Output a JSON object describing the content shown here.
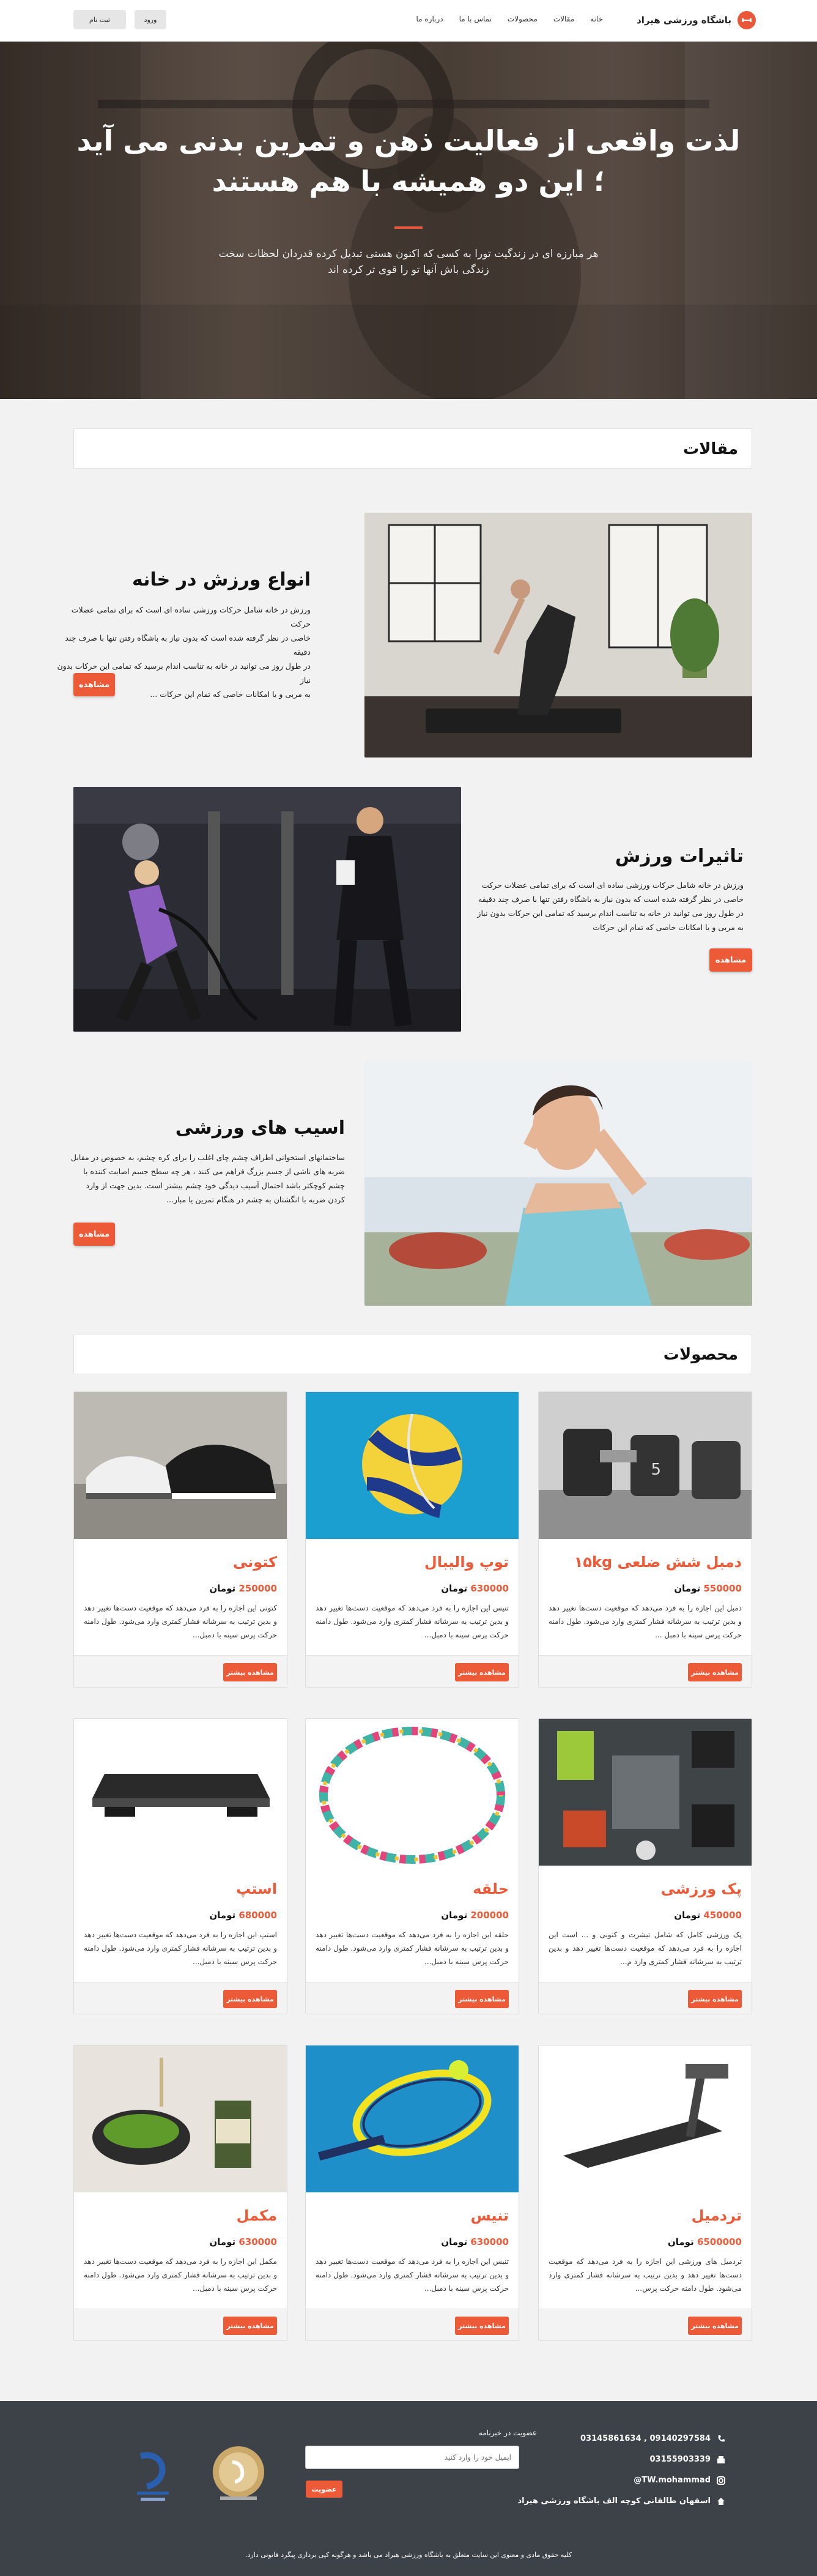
{
  "nav": {
    "brand": "باشگاه ورزشی هیراد",
    "menu": [
      "خانه",
      "مقالات",
      "محصولات",
      "تماس با ما",
      "درباره ما"
    ],
    "login_label": "ورود",
    "signup_label": "ثبت نام"
  },
  "hero": {
    "title_line1": "لذت واقعی از فعالیت ذهن و تمرین بدنی می آید",
    "title_line2": "؛ این دو همیشه با هم هستند",
    "subtitle_line1": "هر مبارزه ای در زندگیت تورا به کسی که اکنون هستی تبدیل کرده قدردان لحظات سخت",
    "subtitle_line2": "زندگی باش آنها تو را قوی تر کرده اند"
  },
  "articles_section": {
    "title": "مقالات",
    "read_more_label": "مشاهده",
    "items": [
      {
        "title": "انواع ورزش در خانه",
        "lines": [
          "ورزش در خانه شامل حرکات ورزشی ساده ای است که برای تمامی عضلات حرکت",
          "خاصی در نظر گرفته شده است که بدون نیاز به باشگاه رفتن تنها با صرف چند دقیقه",
          "در طول روز می توانید در خانه به تناسب اندام برسید که تمامی این حرکات بدون نیاز",
          "به مربی و یا امکانات خاصی که تمام این حرکات ..."
        ]
      },
      {
        "title": "تاثیرات ورزش",
        "lines": [
          "ورزش در خانه شامل حرکات ورزشی ساده ای است که برای تمامی عضلات حرکت",
          "خاصی در نظر گرفته شده است که بدون نیاز به باشگاه رفتن تنها با صرف چند دقیقه",
          "در طول روز می توانید در خانه به تناسب اندام برسید که تمامی این حرکات بدون نیاز",
          "به مربی و یا امکانات خاصی که تمام این حرکات"
        ]
      },
      {
        "title": "اسیب های ورزشی",
        "lines": [
          "ساختمانهای استخوانی اطراف چشم چای اغلب را برای کره چشم، به خصوص در مقابل",
          "ضربه های ناشی از جسم بزرگ فراهم می کنند ، هر چه سطح جسم اصابت کننده با",
          "چشم کوچکتر باشد احتمال آسیب دیدگی خود چشم بیشتر است. بدین جهت از وارد",
          "کردن ضربه با انگشتان به چشم در هنگام تمرین یا مبار..."
        ]
      }
    ]
  },
  "products_section": {
    "title": "محصولات",
    "currency": "تومان",
    "view_label": "مشاهده بیشتر",
    "items": [
      {
        "name": "دمبل شش ضلعی ۱۵kg",
        "price": "550000",
        "desc": "دمبل این اجازه را به فرد می‌دهد که موقعیت دست‌ها تغییر دهد و بدین ترتیب به سرشانه فشار کمتری وارد می‌شود. طول دامنه حرکت پرس سینه با دمبل ..."
      },
      {
        "name": "توپ والیبال",
        "price": "630000",
        "desc": "تنیس این اجازه را به فرد می‌دهد که موقعیت دست‌ها تغییر دهد و بدین ترتیب به سرشانه فشار کمتری وارد می‌شود. طول دامنه حرکت پرس سینه با دمبل..."
      },
      {
        "name": "کتونی",
        "price": "250000",
        "desc": "کتونی این اجازه را به فرد می‌دهد که موقعیت دست‌ها تغییر دهد و بدین ترتیب به سرشانه فشار کمتری وارد می‌شود. طول دامنه حرکت پرس سینه با دمبل..."
      },
      {
        "name": "پک ورزشی",
        "price": "450000",
        "desc": "پک ورزشی کامل که شامل تیشرت و کتونی و ... است این اجازه را به فرد می‌دهد که موقعیت دست‌ها تغییر دهد و بدین ترتیب به سرشانه فشار کمتری وارد م..."
      },
      {
        "name": "حلقه",
        "price": "200000",
        "desc": "حلقه این اجازه را به فرد می‌دهد که موقعیت دست‌ها تغییر دهد و بدین ترتیب به سرشانه فشار کمتری وارد می‌شود. طول دامنه حرکت پرس سینه با دمبل..."
      },
      {
        "name": "استپ",
        "price": "680000",
        "desc": "استپ این اجازه را به فرد می‌دهد که موقعیت دست‌ها تغییر دهد و بدین ترتیب به سرشانه فشار کمتری وارد می‌شود. طول دامنه حرکت پرس سینه با دمبل..."
      },
      {
        "name": "تردمیل",
        "price": "6500000",
        "desc": "تردمیل های ورزشی این اجازه را به فرد می‌دهد که موقعیت دست‌ها تغییر دهد و بدین ترتیب به سرشانه فشار کمتری وارد می‌شود. طول دامنه حرکت پرس..."
      },
      {
        "name": "تنیس",
        "price": "630000",
        "desc": "تنیس این اجازه را به فرد می‌دهد که موقعیت دست‌ها تغییر دهد و بدین ترتیب به سرشانه فشار کمتری وارد می‌شود. طول دامنه حرکت پرس سینه با دمبل..."
      },
      {
        "name": "مکمل",
        "price": "630000",
        "desc": "مکمل این اجازه را به فرد می‌دهد که موقعیت دست‌ها تغییر دهد و بدین ترتیب به سرشانه فشار کمتری وارد می‌شود. طول دامنه حرکت پرس سینه با دمبل..."
      }
    ]
  },
  "footer": {
    "phones": "09140297584 , 03145861634",
    "fax": "03155903339",
    "instagram": "TW.mohammad@",
    "address": "اسفهان طالقانی کوچه الف باشگاه ورزشی هیراد",
    "newsletter_title": "عضویت در خبرنامه",
    "newsletter_placeholder": "ایمیل خود را وارد کنید",
    "subscribe_label": "عضویت",
    "copyright": "کلیه حقوق مادی و معنوی این سایت متعلق به باشگاه ورزشی هیراد می باشد و هرگونه کپی برداری پیگرد قانونی دارد."
  },
  "colors": {
    "accent": "#ec5a38",
    "footer_bg": "#3d4148"
  }
}
